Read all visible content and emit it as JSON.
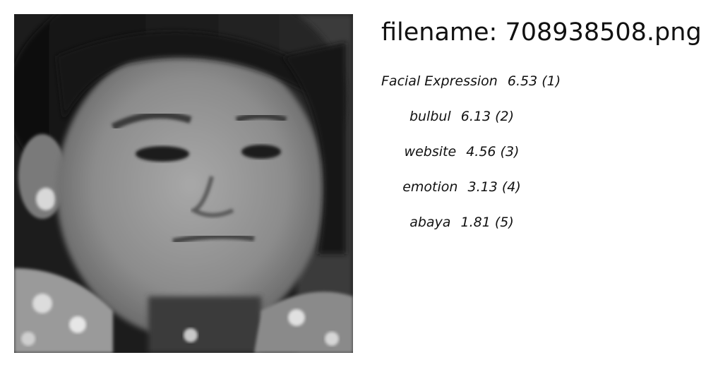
{
  "header": {
    "filename_label": "filename:",
    "filename": "708938508.png"
  },
  "predictions": [
    {
      "label": "Facial Expression",
      "score": "6.53",
      "rank": "(1)"
    },
    {
      "label": "bulbul",
      "score": "6.13",
      "rank": "(2)"
    },
    {
      "label": "website",
      "score": "4.56",
      "rank": "(3)"
    },
    {
      "label": "emotion",
      "score": "3.13",
      "rank": "(4)"
    },
    {
      "label": "abaya",
      "score": "1.81",
      "rank": "(5)"
    }
  ]
}
